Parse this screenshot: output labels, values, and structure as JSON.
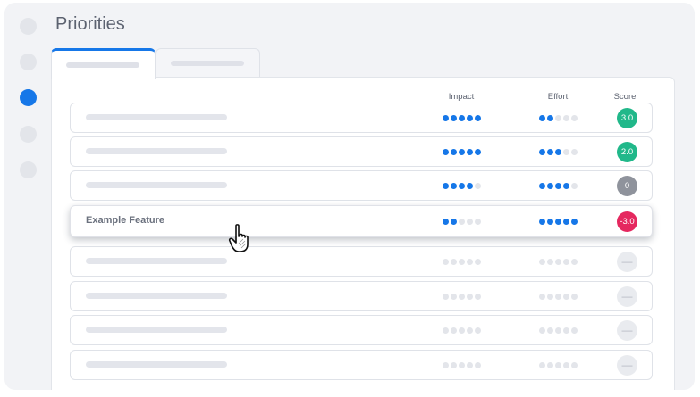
{
  "page": {
    "title": "Priorities"
  },
  "columns": {
    "impact": "Impact",
    "effort": "Effort",
    "score": "Score"
  },
  "colors": {
    "accent": "#1677e8",
    "positive": "#21b88a",
    "neutral": "#8f939c",
    "negative": "#e5285f"
  },
  "rows": [
    {
      "label": "",
      "impact": 5,
      "effort": 2,
      "score": "3.0",
      "score_color": "#21b88a"
    },
    {
      "label": "",
      "impact": 5,
      "effort": 3,
      "score": "2.0",
      "score_color": "#21b88a"
    },
    {
      "label": "",
      "impact": 4,
      "effort": 4,
      "score": "0",
      "score_color": "#8f939c"
    },
    {
      "label": "Example Feature",
      "impact": 2,
      "effort": 5,
      "score": "-3.0",
      "score_color": "#e5285f"
    },
    {
      "label": "",
      "impact": 0,
      "effort": 0,
      "score": "—",
      "score_color": ""
    },
    {
      "label": "",
      "impact": 0,
      "effort": 0,
      "score": "—",
      "score_color": ""
    },
    {
      "label": "",
      "impact": 0,
      "effort": 0,
      "score": "—",
      "score_color": ""
    },
    {
      "label": "",
      "impact": 0,
      "effort": 0,
      "score": "—",
      "score_color": ""
    }
  ],
  "icons": {
    "cursor": "pointing-hand-icon"
  }
}
